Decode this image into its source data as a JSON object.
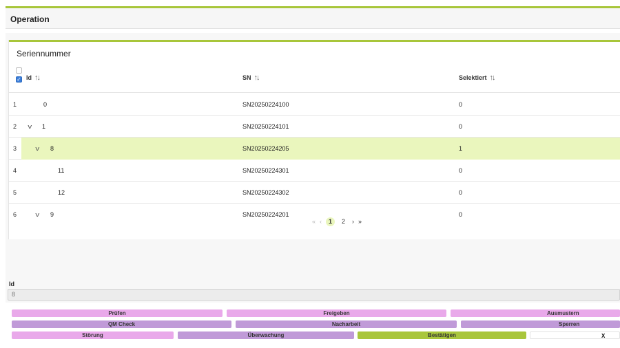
{
  "operation": {
    "title": "Operation"
  },
  "card": {
    "title": "Seriennummer"
  },
  "table": {
    "headers": {
      "id": "Id",
      "sn": "SN",
      "selektiert": "Selektiert"
    },
    "rows": [
      {
        "index": "1",
        "id": "0",
        "sn": "SN20250224100",
        "selektiert": "0"
      },
      {
        "index": "2",
        "id": "1",
        "sn": "SN20250224101",
        "selektiert": "0"
      },
      {
        "index": "3",
        "id": "8",
        "sn": "SN20250224205",
        "selektiert": "1"
      },
      {
        "index": "4",
        "id": "11",
        "sn": "SN20250224301",
        "selektiert": "0"
      },
      {
        "index": "5",
        "id": "12",
        "sn": "SN20250224302",
        "selektiert": "0"
      },
      {
        "index": "6",
        "id": "9",
        "sn": "SN20250224201",
        "selektiert": "0"
      }
    ]
  },
  "pagination": {
    "first": "«",
    "prev": "‹",
    "pages": [
      "1",
      "2"
    ],
    "next": "›",
    "last": "»"
  },
  "id_field": {
    "label": "Id",
    "value": "8"
  },
  "buttons": {
    "pruefen": "Prüfen",
    "freigeben": "Freigeben",
    "ausmustern": "Ausmustern",
    "qm_check": "QM Check",
    "nacharbeit": "Nacharbeit",
    "sperren": "Sperren",
    "stoerung": "Störung",
    "ueberwachung": "Überwachung",
    "bestaetigen": "Bestätigen",
    "close": "X"
  },
  "colors": {
    "accent_green": "#a8c63a",
    "selected_row": "#eaf6bd",
    "button_pink": "#e9a9ea",
    "button_purple": "#c09ad8",
    "checkbox_blue": "#3b7dd8"
  }
}
